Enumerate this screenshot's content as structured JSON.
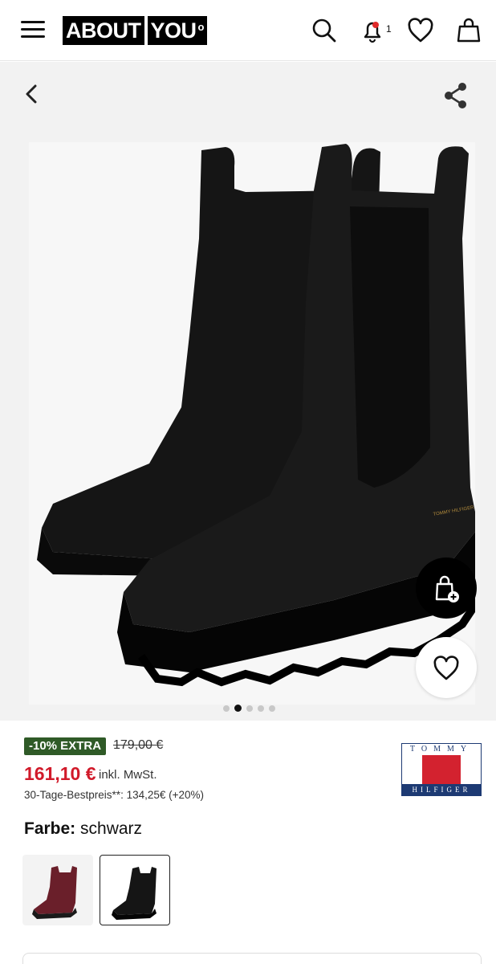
{
  "header": {
    "logo_left": "ABOUT",
    "logo_right": "YOU",
    "logo_mark": "o",
    "notification_count": "1"
  },
  "product": {
    "extra_badge": "-10% EXTRA",
    "old_price": "179,00 €",
    "price": "161,10 €",
    "tax_note": "inkl. MwSt.",
    "best_price": "30-Tage-Bestpreis**: 134,25€ (+20%)",
    "brand_top": "TOMMY",
    "brand_bottom": "HILFIGER",
    "color_label": "Farbe:",
    "color_value": "schwarz"
  },
  "gallery": {
    "image_count": 5,
    "active_index": 1
  },
  "colors": {
    "price_red": "#d11a2a",
    "badge_green": "#2f5a27",
    "tommy_navy": "#1d3a73",
    "tommy_red": "#d3222f"
  }
}
